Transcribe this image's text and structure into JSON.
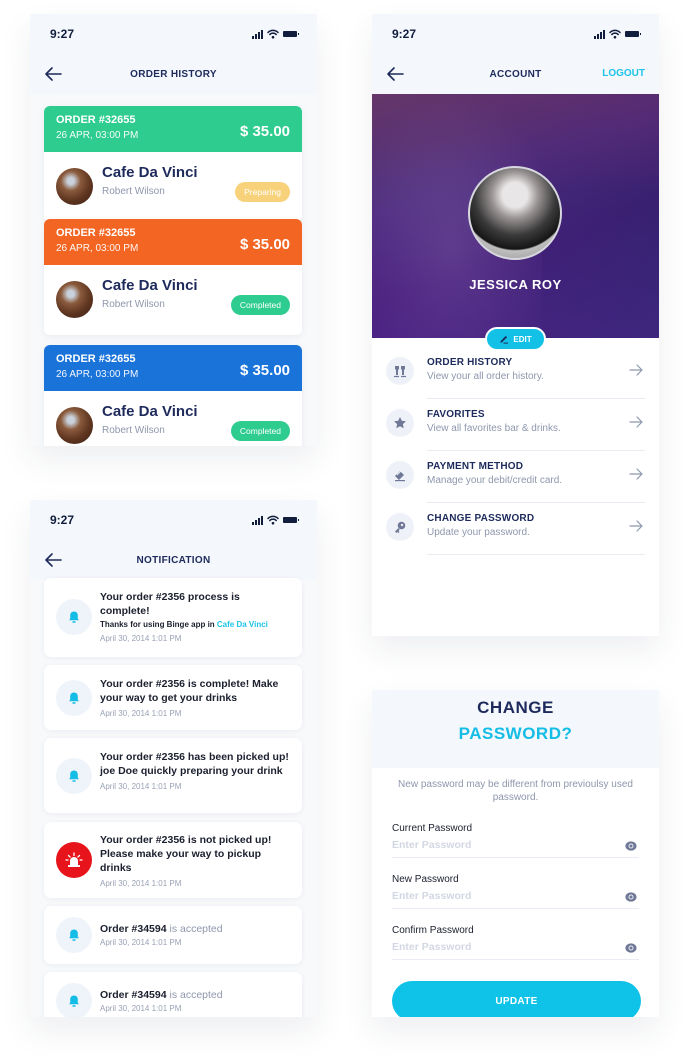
{
  "status_time": "9:27",
  "order_history": {
    "title": "ORDER HISTORY",
    "orders": [
      {
        "order_no": "ORDER #32655",
        "date": "26 APR, 03:00 PM",
        "price": "$ 35.00",
        "cafe": "Cafe Da Vinci",
        "person": "Robert Wilson",
        "status": "Preparing",
        "header_color": "#2ecc8f",
        "badge_color": "#f8d27a"
      },
      {
        "order_no": "ORDER #32655",
        "date": "26 APR, 03:00 PM",
        "price": "$ 35.00",
        "cafe": "Cafe Da Vinci",
        "person": "Robert Wilson",
        "status": "Completed",
        "header_color": "#f26522",
        "badge_color": "#2ecc8f"
      },
      {
        "order_no": "ORDER #32655",
        "date": "26 APR, 03:00 PM",
        "price": "$ 35.00",
        "cafe": "Cafe Da Vinci",
        "person": "Robert Wilson",
        "status": "Completed",
        "header_color": "#1a73d9",
        "badge_color": "#2ecc8f"
      }
    ]
  },
  "account": {
    "title": "ACCOUNT",
    "logout_label": "LOGOUT",
    "user_name": "JESSICA ROY",
    "edit_label": "EDIT",
    "menu": [
      {
        "title": "ORDER HISTORY",
        "subtitle": "View your all order history.",
        "icon": "drinks-icon"
      },
      {
        "title": "FAVORITES",
        "subtitle": "View all favorites bar & drinks.",
        "icon": "star-icon"
      },
      {
        "title": "PAYMENT METHOD",
        "subtitle": "Manage your debit/credit card.",
        "icon": "card-icon"
      },
      {
        "title": "CHANGE PASSWORD",
        "subtitle": "Update your password.",
        "icon": "key-icon"
      }
    ]
  },
  "notification": {
    "title": "NOTIFICATION",
    "items": [
      {
        "text": "Your order #2356 process is complete!",
        "sub_prefix": "Thanks for using Binge app in ",
        "sub_link": "Cafe Da Vinci",
        "date": "April 30, 2014 1:01 PM",
        "type": "bell"
      },
      {
        "text": "Your order #2356 is complete! Make your way to get your drinks",
        "date": "April 30, 2014 1:01 PM",
        "type": "bell"
      },
      {
        "text": "Your order #2356 has been picked up! joe Doe quickly preparing your drink",
        "date": "April 30, 2014 1:01 PM",
        "type": "bell"
      },
      {
        "text": "Your order #2356 is not picked up! Please make your way to pickup drinks",
        "date": "April 30, 2014 1:01 PM",
        "type": "alert"
      },
      {
        "text_bold": "Order #34594",
        "text_light": " is accepted",
        "date": "April 30, 2014 1:01 PM",
        "type": "bell"
      },
      {
        "text_bold": "Order #34594",
        "text_light": " is accepted",
        "date": "April 30, 2014 1:01 PM",
        "type": "bell"
      }
    ]
  },
  "change_password": {
    "title_line1": "CHANGE",
    "title_line2": "PASSWORD?",
    "info": "New password may be different from previoulsy used password.",
    "fields": [
      {
        "label": "Current Password",
        "placeholder": "Enter Password",
        "value": ""
      },
      {
        "label": "New Password",
        "placeholder": "Enter Password",
        "value": ""
      },
      {
        "label": "Confirm Password",
        "placeholder": "Enter Password",
        "value": ""
      }
    ],
    "update_label": "UPDATE"
  },
  "colors": {
    "accent": "#14bde5",
    "navy": "#1d2a5b",
    "alert": "#e8141b"
  }
}
